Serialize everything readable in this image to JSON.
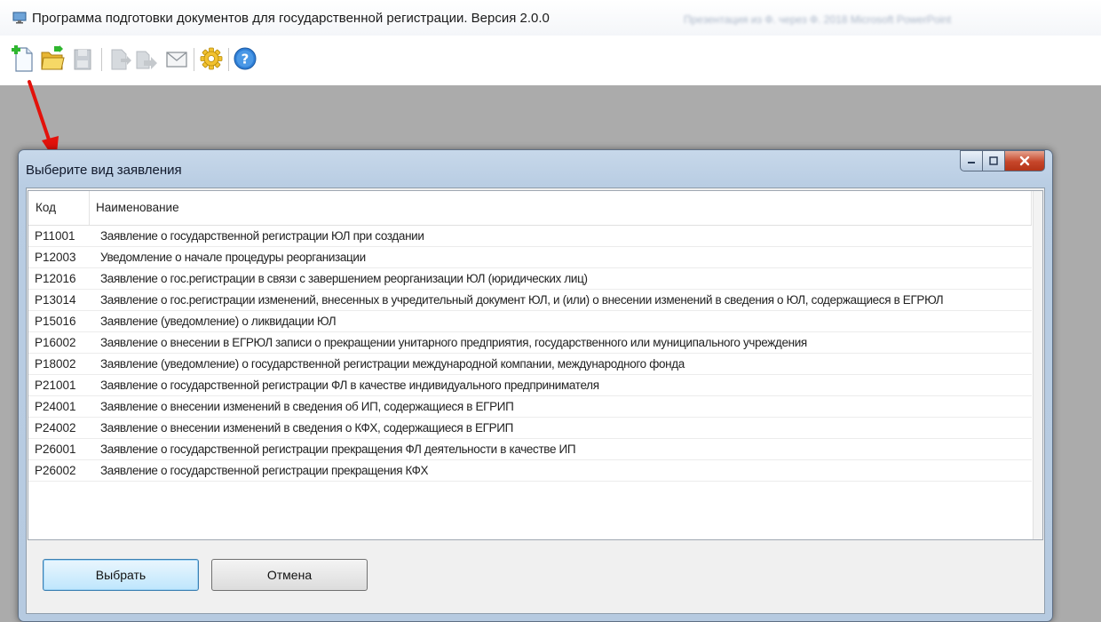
{
  "main_window": {
    "title": "Программа подготовки документов для государственной регистрации. Версия 2.0.0",
    "title_right_blurred": "Презентация из Ф. через Ф. 2018 Microsoft PowerPoint"
  },
  "toolbar": {
    "buttons": [
      {
        "icon": "new-document-icon",
        "enabled": true
      },
      {
        "icon": "open-folder-icon",
        "enabled": true
      },
      {
        "icon": "save-icon",
        "enabled": false
      },
      {
        "icon": "export-icon",
        "enabled": false
      },
      {
        "icon": "send-icon",
        "enabled": false
      },
      {
        "icon": "envelope-icon",
        "enabled": false
      },
      {
        "icon": "settings-gear-icon",
        "enabled": true
      },
      {
        "icon": "help-icon",
        "enabled": true
      }
    ]
  },
  "annotation": {
    "color": "#e3120b",
    "type": "arrow"
  },
  "dialog": {
    "title": "Выберите вид заявления",
    "columns": {
      "code": "Код",
      "name": "Наименование"
    },
    "rows": [
      {
        "code": "P11001",
        "name": "Заявление о государственной регистрации ЮЛ при создании"
      },
      {
        "code": "P12003",
        "name": "Уведомление о начале процедуры реорганизации"
      },
      {
        "code": "P12016",
        "name": "Заявление о гос.регистрации в связи с завершением реорганизации ЮЛ (юридических лиц)"
      },
      {
        "code": "P13014",
        "name": "Заявление о гос.регистрации изменений, внесенных в учредительный документ ЮЛ, и (или) о внесении изменений в сведения о ЮЛ, содержащиеся в ЕГРЮЛ"
      },
      {
        "code": "P15016",
        "name": "Заявление (уведомление) о ликвидации ЮЛ"
      },
      {
        "code": "P16002",
        "name": "Заявление о внесении в ЕГРЮЛ записи о прекращении унитарного предприятия, государственного или муниципального учреждения"
      },
      {
        "code": "P18002",
        "name": "Заявление (уведомление) о государственной регистрации международной компании, международного фонда"
      },
      {
        "code": "P21001",
        "name": "Заявление о государственной регистрации ФЛ в качестве индивидуального предпринимателя"
      },
      {
        "code": "P24001",
        "name": "Заявление о внесении изменений в сведения об ИП, содержащиеся в ЕГРИП"
      },
      {
        "code": "P24002",
        "name": "Заявление о внесении изменений в сведения о КФХ, содержащиеся в ЕГРИП"
      },
      {
        "code": "P26001",
        "name": "Заявление о государственной регистрации прекращения ФЛ деятельности в качестве ИП"
      },
      {
        "code": "P26002",
        "name": "Заявление о государственной регистрации прекращения КФХ"
      }
    ],
    "buttons": {
      "select": "Выбрать",
      "cancel": "Отмена"
    }
  }
}
